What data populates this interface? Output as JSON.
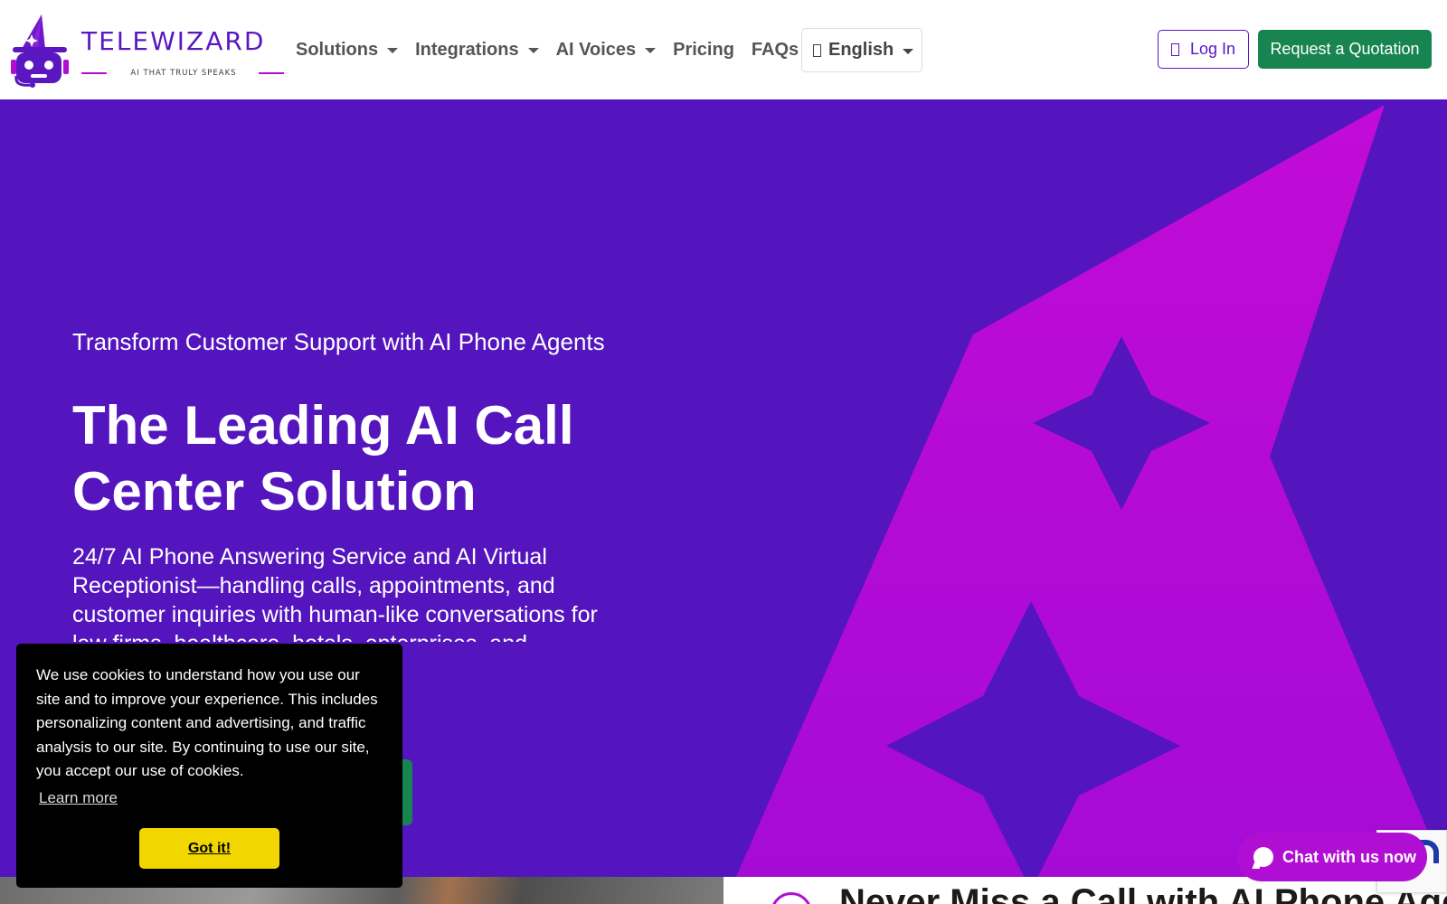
{
  "brand": {
    "name": "TELEWIZARD",
    "tagline": "AI THAT TRULY SPEAKS",
    "colors": {
      "primary": "#5415be",
      "accent": "#b00fd3",
      "cta": "#18844f",
      "cookie_button": "#f1d600"
    }
  },
  "nav": {
    "items": [
      {
        "label": "Solutions",
        "dropdown": true
      },
      {
        "label": "Integrations",
        "dropdown": true
      },
      {
        "label": "AI Voices",
        "dropdown": true
      },
      {
        "label": "Pricing",
        "dropdown": false
      },
      {
        "label": "FAQs",
        "dropdown": false
      }
    ],
    "language": {
      "label": "English",
      "icon": "globe-icon"
    },
    "login_label": "Log In",
    "login_icon": "login-icon",
    "quote_label": "Request a Quotation"
  },
  "hero": {
    "subtitle": "Transform Customer Support with AI Phone Agents",
    "title": "The Leading AI Call Center Solution",
    "description": "24/7 AI Phone Answering Service and AI Virtual Receptionist—handling calls, appointments, and customer inquiries with human-like conversations for law firms, healthcare, hotels, enterprises, and"
  },
  "next_section": {
    "heading": "Never Miss a Call with AI Phone Agents"
  },
  "cookie": {
    "message": "We use cookies to understand how you use our site and to improve your experience. This includes personalizing content and advertising, and traffic analysis to our site. By continuing to use our site, you accept our use of cookies.",
    "learn_more": "Learn more",
    "accept": "Got it!"
  },
  "chat": {
    "label": "Chat with us now",
    "icon": "chat-bubble-icon"
  }
}
